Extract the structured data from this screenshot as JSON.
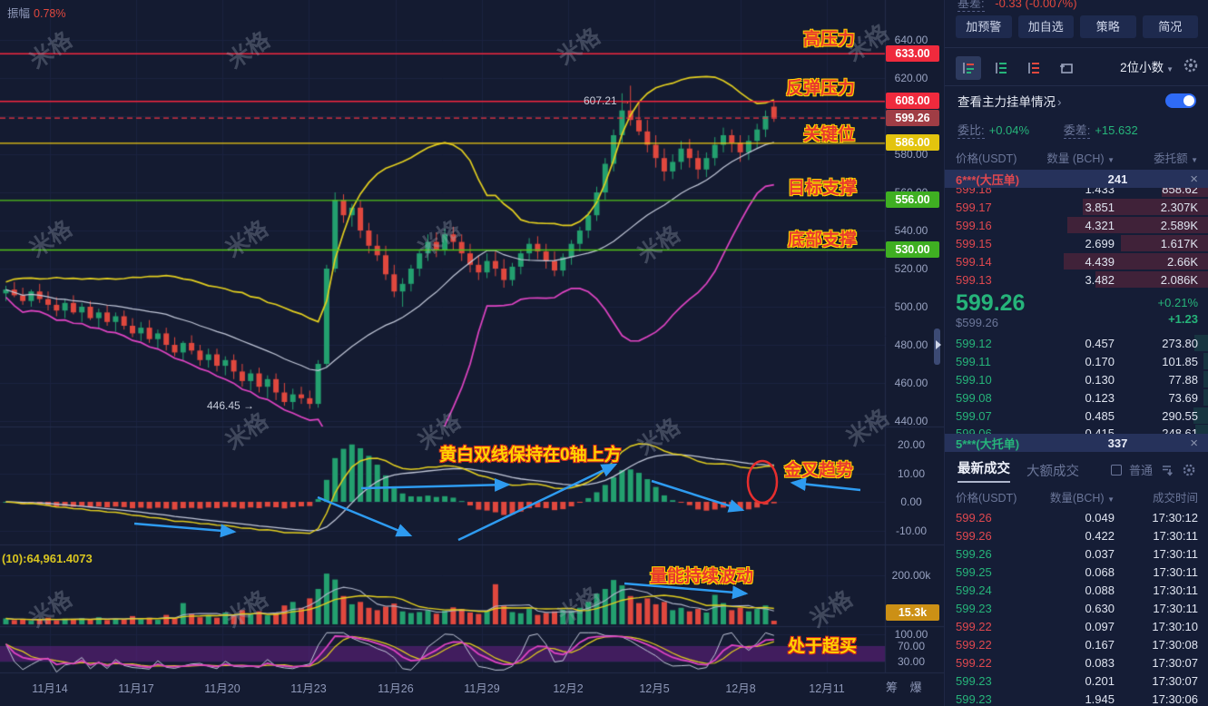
{
  "watermark": "米格",
  "chart": {
    "amplitude": {
      "label": "振幅",
      "value": "0.78%"
    },
    "vol_ma_label": "(10):64,961.4073",
    "peak_marker": "607.21",
    "low_marker": "446.45",
    "corner_label": "筹 爆",
    "annotations": {
      "high_pressure": "高压力",
      "rebound_pressure": "反弹压力",
      "key_level": "关键位",
      "target_support": "目标支撑",
      "bottom_support": "底部支撑",
      "macd_note": "黄白双线保持在0轴上方",
      "golden_cross": "金叉趋势",
      "volume_note": "量能持续波动",
      "overbought": "处于超买"
    }
  },
  "chart_data": {
    "type": "candlestick",
    "quote": "USDT",
    "x_labels": [
      "11月14",
      "11月17",
      "11月20",
      "11月23",
      "11月26",
      "11月29",
      "12月2",
      "12月5",
      "12月8",
      "12月11"
    ],
    "x_positions": [
      55,
      150,
      245,
      340,
      436,
      531,
      626,
      721,
      816,
      911
    ],
    "price_ticks": [
      "640.00",
      "620.00",
      "600.00",
      "580.00",
      "560.00",
      "540.00",
      "520.00",
      "500.00",
      "480.00",
      "460.00",
      "440.00"
    ],
    "macd_ticks": [
      "20.00",
      "10.00",
      "0.00",
      "-10.00"
    ],
    "vol_tick": "200.00k",
    "vol_badge": "15.3k",
    "osc_ticks": [
      "100.00",
      "70.00",
      "30.00"
    ],
    "current_price": 599.26,
    "levels": [
      {
        "label": "633.00",
        "price": 633,
        "line": "#f2273f",
        "badge": "#ef2a3d",
        "style": "solid",
        "role": "high-pressure"
      },
      {
        "label": "608.00",
        "price": 608,
        "line": "#f2273f",
        "badge": "#ef2a3d",
        "style": "solid",
        "role": "rebound-pressure"
      },
      {
        "label": "599.26",
        "price": 599.26,
        "line": "#f23645",
        "badge": "#a03d45",
        "style": "dashed",
        "role": "current-price"
      },
      {
        "label": "586.00",
        "price": 586,
        "line": "#f0cc12",
        "badge": "#e3c40e",
        "style": "solid",
        "role": "key-level"
      },
      {
        "label": "556.00",
        "price": 556,
        "line": "#53c41a",
        "badge": "#3faf22",
        "style": "solid",
        "role": "target-support"
      },
      {
        "label": "530.00",
        "price": 530,
        "line": "#53c41a",
        "badge": "#3faf22",
        "style": "solid",
        "role": "bottom-support"
      }
    ],
    "candles": [
      [
        507,
        511,
        503,
        509
      ],
      [
        509,
        513,
        505,
        506
      ],
      [
        506,
        510,
        501,
        503
      ],
      [
        503,
        509,
        500,
        508
      ],
      [
        508,
        512,
        502,
        504
      ],
      [
        504,
        508,
        498,
        501
      ],
      [
        501,
        505,
        495,
        498
      ],
      [
        498,
        504,
        494,
        502
      ],
      [
        502,
        506,
        496,
        497
      ],
      [
        497,
        502,
        492,
        500
      ],
      [
        500,
        503,
        493,
        494
      ],
      [
        494,
        499,
        489,
        497
      ],
      [
        497,
        501,
        490,
        492
      ],
      [
        492,
        497,
        487,
        495
      ],
      [
        495,
        498,
        488,
        490
      ],
      [
        490,
        494,
        484,
        486
      ],
      [
        486,
        492,
        482,
        489
      ],
      [
        489,
        493,
        481,
        483
      ],
      [
        483,
        488,
        478,
        486
      ],
      [
        486,
        489,
        477,
        480
      ],
      [
        480,
        484,
        474,
        476
      ],
      [
        476,
        482,
        472,
        481
      ],
      [
        481,
        485,
        475,
        477
      ],
      [
        477,
        480,
        469,
        472
      ],
      [
        472,
        478,
        468,
        475
      ],
      [
        475,
        478,
        466,
        469
      ],
      [
        469,
        474,
        464,
        472
      ],
      [
        472,
        475,
        462,
        466
      ],
      [
        466,
        470,
        458,
        461
      ],
      [
        461,
        467,
        456,
        465
      ],
      [
        465,
        468,
        455,
        458
      ],
      [
        458,
        464,
        452,
        462
      ],
      [
        462,
        465,
        451,
        455
      ],
      [
        455,
        460,
        448,
        450
      ],
      [
        450,
        457,
        446,
        454
      ],
      [
        454,
        458,
        449,
        452
      ],
      [
        452,
        456,
        446.45,
        449
      ],
      [
        449,
        472,
        447,
        470
      ],
      [
        470,
        522,
        468,
        520
      ],
      [
        520,
        560,
        518,
        556
      ],
      [
        556,
        559,
        544,
        548
      ],
      [
        548,
        554,
        542,
        552
      ],
      [
        552,
        556,
        536,
        540
      ],
      [
        540,
        544,
        528,
        532
      ],
      [
        532,
        538,
        524,
        527
      ],
      [
        527,
        532,
        514,
        517
      ],
      [
        517,
        522,
        505,
        508
      ],
      [
        508,
        515,
        500,
        512
      ],
      [
        512,
        522,
        508,
        520
      ],
      [
        520,
        530,
        516,
        528
      ],
      [
        528,
        538,
        524,
        534
      ],
      [
        534,
        539,
        526,
        530
      ],
      [
        530,
        541,
        527,
        538
      ],
      [
        538,
        542,
        530,
        534
      ],
      [
        534,
        538,
        524,
        528
      ],
      [
        528,
        533,
        518,
        522
      ],
      [
        522,
        527,
        514,
        518
      ],
      [
        518,
        528,
        515,
        524
      ],
      [
        524,
        529,
        516,
        520
      ],
      [
        520,
        525,
        510,
        514
      ],
      [
        514,
        523,
        511,
        521
      ],
      [
        521,
        530,
        517,
        528
      ],
      [
        528,
        536,
        524,
        533
      ],
      [
        533,
        537,
        525,
        529
      ],
      [
        529,
        533,
        520,
        524
      ],
      [
        524,
        529,
        516,
        519
      ],
      [
        519,
        528,
        516,
        526
      ],
      [
        526,
        535,
        522,
        533
      ],
      [
        533,
        542,
        529,
        540
      ],
      [
        540,
        550,
        536,
        548
      ],
      [
        548,
        563,
        545,
        560
      ],
      [
        560,
        578,
        556,
        575
      ],
      [
        575,
        593,
        571,
        590
      ],
      [
        590,
        612,
        586,
        603
      ],
      [
        603,
        616,
        595,
        598
      ],
      [
        598,
        607,
        590,
        592
      ],
      [
        592,
        598,
        581,
        585
      ],
      [
        585,
        590,
        573,
        578
      ],
      [
        578,
        583,
        566,
        571
      ],
      [
        571,
        580,
        567,
        576
      ],
      [
        576,
        587,
        572,
        583
      ],
      [
        583,
        588,
        573,
        578
      ],
      [
        578,
        582,
        567,
        572
      ],
      [
        572,
        581,
        568,
        578
      ],
      [
        578,
        589,
        574,
        585
      ],
      [
        585,
        594,
        581,
        590
      ],
      [
        590,
        593,
        581,
        586
      ],
      [
        586,
        590,
        576,
        581
      ],
      [
        581,
        590,
        577,
        587
      ],
      [
        587,
        596,
        583,
        593
      ],
      [
        593,
        603,
        589,
        600
      ],
      [
        605,
        608,
        597,
        599.26
      ]
    ],
    "volumes_k": [
      25,
      18,
      22,
      15,
      20,
      28,
      17,
      24,
      19,
      26,
      21,
      30,
      18,
      24,
      20,
      35,
      22,
      28,
      19,
      40,
      26,
      90,
      45,
      30,
      38,
      28,
      50,
      36,
      60,
      42,
      55,
      38,
      48,
      80,
      95,
      70,
      110,
      150,
      215,
      190,
      120,
      85,
      95,
      70,
      60,
      75,
      88,
      55,
      48,
      52,
      60,
      45,
      58,
      72,
      65,
      50,
      44,
      56,
      170,
      80,
      52,
      47,
      65,
      40,
      48,
      55,
      62,
      58,
      70,
      95,
      130,
      150,
      188,
      165,
      120,
      90,
      110,
      85,
      95,
      60,
      70,
      55,
      65,
      50,
      125,
      90,
      60,
      70,
      55,
      65,
      80,
      15.3
    ]
  },
  "side_panel": {
    "basis": {
      "label": "基差:",
      "value": "-0.33 (-0.007%)"
    },
    "buttons": [
      "加预警",
      "加自选",
      "策略",
      "简况"
    ],
    "decimal_selector": "2位小数",
    "main_order_link": "查看主力挂单情况",
    "ratio": {
      "label": "委比:",
      "value": "+0.04%"
    },
    "diff": {
      "label": "委差:",
      "value": "+15.632"
    },
    "orderbook": {
      "headers": [
        "价格(USDT)",
        "数量 (BCH)",
        "委托额"
      ],
      "sell_overlay": {
        "name": "6***(大压单)",
        "count": "241"
      },
      "asks_clipped": {
        "price": "599.18",
        "amount": "1.433",
        "total": "858.62"
      },
      "asks": [
        {
          "price": "599.17",
          "amount": "3.851",
          "total": "2.307K"
        },
        {
          "price": "599.16",
          "amount": "4.321",
          "total": "2.589K"
        },
        {
          "price": "599.15",
          "amount": "2.699",
          "total": "1.617K"
        },
        {
          "price": "599.14",
          "amount": "4.439",
          "total": "2.66K"
        },
        {
          "price": "599.13",
          "amamount": "",
          "amount": "3.482",
          "total": "2.086K"
        }
      ],
      "last": {
        "price": "599.26",
        "usd": "$599.26",
        "change_pct": "+0.21%",
        "change_abs": "+1.23"
      },
      "bids": [
        {
          "price": "599.12",
          "amount": "0.457",
          "total": "273.80"
        },
        {
          "price": "599.11",
          "amount": "0.170",
          "total": "101.85"
        },
        {
          "price": "599.10",
          "amount": "0.130",
          "total": "77.88"
        },
        {
          "price": "599.08",
          "amount": "0.123",
          "total": "73.69"
        },
        {
          "price": "599.07",
          "amount": "0.485",
          "total": "290.55"
        }
      ],
      "bids_clipped": {
        "price": "599.06",
        "amount": "0.415",
        "total": "248.61"
      },
      "buy_overlay": {
        "name": "5***(大托单)",
        "count": "337"
      }
    },
    "trades": {
      "tabs": [
        "最新成交",
        "大额成交"
      ],
      "filter_label": "普通",
      "headers": [
        "价格(USDT)",
        "数量(BCH)",
        "成交时间"
      ],
      "rows": [
        {
          "price": "599.26",
          "amount": "0.049",
          "time": "17:30:12",
          "side": "sell"
        },
        {
          "price": "599.26",
          "amount": "0.422",
          "time": "17:30:11",
          "side": "sell"
        },
        {
          "price": "599.26",
          "amount": "0.037",
          "time": "17:30:11",
          "side": "buy"
        },
        {
          "price": "599.25",
          "amount": "0.068",
          "time": "17:30:11",
          "side": "buy"
        },
        {
          "price": "599.24",
          "amount": "0.088",
          "time": "17:30:11",
          "side": "buy"
        },
        {
          "price": "599.23",
          "amount": "0.630",
          "time": "17:30:11",
          "side": "buy"
        },
        {
          "price": "599.22",
          "amount": "0.097",
          "time": "17:30:10",
          "side": "sell"
        },
        {
          "price": "599.22",
          "amount": "0.167",
          "time": "17:30:08",
          "side": "sell"
        },
        {
          "price": "599.22",
          "amount": "0.083",
          "time": "17:30:07",
          "side": "sell"
        },
        {
          "price": "599.23",
          "amount": "0.201",
          "time": "17:30:07",
          "side": "buy"
        },
        {
          "price": "599.23",
          "amount": "1.945",
          "time": "17:30:06",
          "side": "buy"
        }
      ]
    }
  }
}
